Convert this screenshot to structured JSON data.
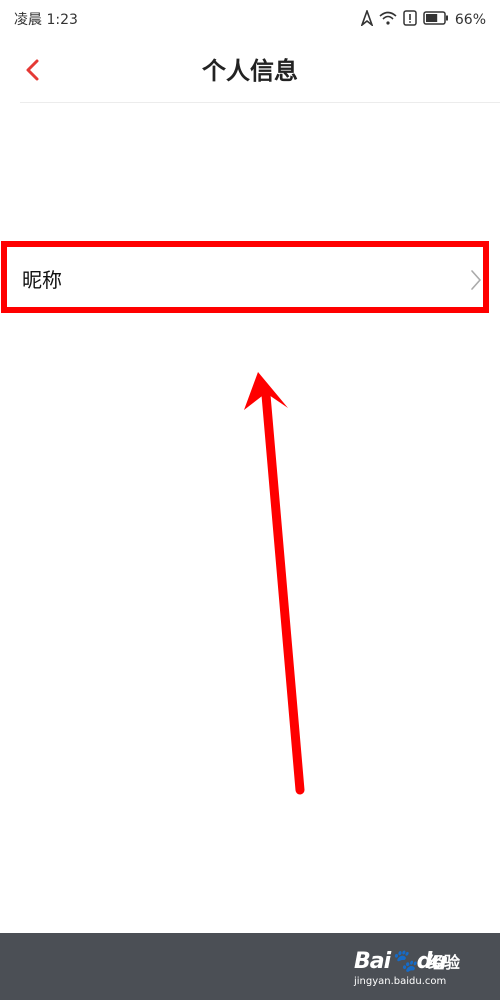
{
  "status_bar": {
    "time": "凌晨  1:23",
    "battery_percent": "66%",
    "battery_level": 0.66,
    "icons": [
      "location-icon",
      "wifi-icon",
      "alert-icon",
      "battery-icon"
    ]
  },
  "header": {
    "title": "个人信息",
    "back_icon": "chevron-left-icon"
  },
  "list": {
    "items": [
      {
        "label": "昵称",
        "icon": "chevron-right-icon"
      }
    ]
  },
  "watermark": {
    "brand": "Bai",
    "brand_suffix": "du",
    "product": "经验",
    "url": "jingyan.baidu.com"
  },
  "colors": {
    "accent_red": "#e53935",
    "annotation_red": "#ff0000",
    "footer_bg": "#4b4f55"
  }
}
